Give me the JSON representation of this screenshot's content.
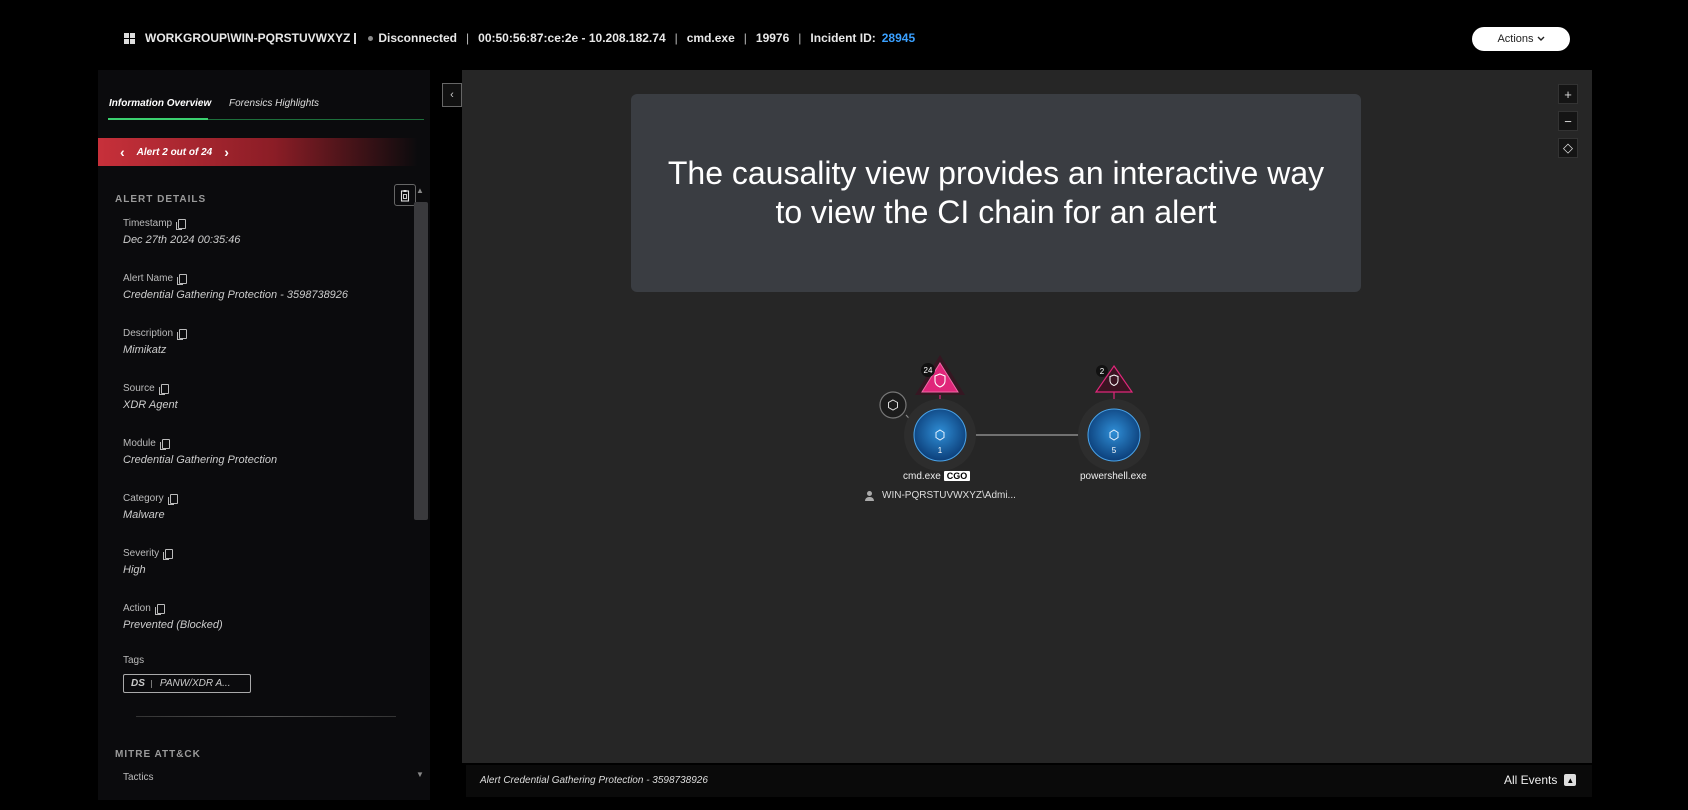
{
  "header": {
    "workgroup": "WORKGROUP\\WIN-PQRSTUVWXYZ",
    "status": "Disconnected",
    "mac_ip": "00:50:56:87:ce:2e - 10.208.182.74",
    "process": "cmd.exe",
    "pid": "19976",
    "incident_label": "Incident ID:",
    "incident_id": "28945",
    "actions_label": "Actions",
    "incident_color": "#3aa0ff"
  },
  "tabs": [
    {
      "label": "Information Overview",
      "active": true
    },
    {
      "label": "Forensics Highlights",
      "active": false
    }
  ],
  "alert_nav": {
    "label": "Alert 2 out of 24"
  },
  "alert_details": {
    "title": "ALERT DETAILS",
    "fields": [
      {
        "label": "Timestamp",
        "value": "Dec 27th 2024 00:35:46"
      },
      {
        "label": "Alert Name",
        "value": "Credential Gathering Protection - 3598738926"
      },
      {
        "label": "Description",
        "value": "Mimikatz"
      },
      {
        "label": "Source",
        "value": "XDR Agent"
      },
      {
        "label": "Module",
        "value": "Credential Gathering Protection"
      },
      {
        "label": "Category",
        "value": "Malware"
      },
      {
        "label": "Severity",
        "value": "High"
      },
      {
        "label": "Action",
        "value": "Prevented (Blocked)"
      }
    ],
    "tags_label": "Tags",
    "tag": {
      "prefix": "DS",
      "text": "PANW/XDR A..."
    }
  },
  "mitre": {
    "title": "MITRE ATT&CK",
    "tactics_label": "Tactics"
  },
  "canvas": {
    "overlay_text": "The causality view provides an interactive way to view the CI chain for an alert",
    "zoom_in": "+",
    "zoom_out": "−",
    "fit": "◇"
  },
  "graph": {
    "nodes": [
      {
        "name": "cmd.exe",
        "badge": "CGO",
        "count": "1",
        "alert_count": "24"
      },
      {
        "name": "powershell.exe",
        "count": "5",
        "alert_count": "2"
      }
    ],
    "user": "WIN-PQRSTUVWXYZ\\Admi...",
    "alert_color": "#e0267a"
  },
  "bottom": {
    "alert_text": "Alert Credential Gathering Protection - 3598738926",
    "all_events": "All Events",
    "up_icon": "▲"
  }
}
